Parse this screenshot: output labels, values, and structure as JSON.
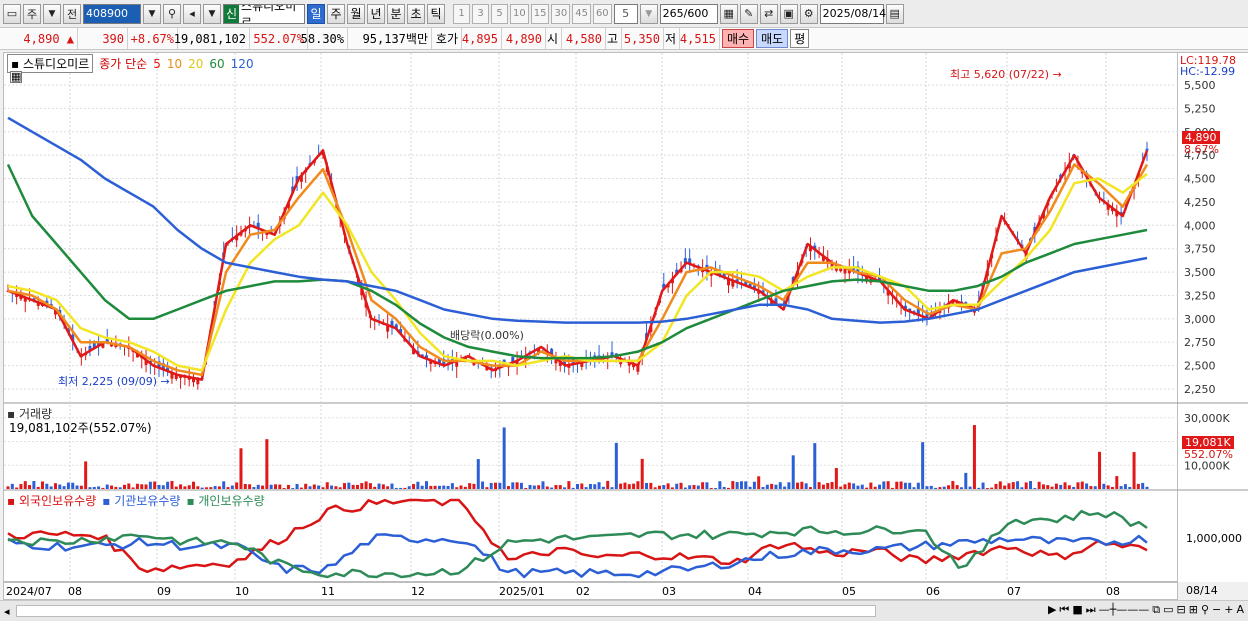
{
  "toolbar": {
    "market": "주",
    "prev_label": "전",
    "code": "408900",
    "name_tag": "신",
    "name": "스튜디오미르",
    "periods": [
      "일",
      "주",
      "월",
      "년",
      "분",
      "초",
      "틱"
    ],
    "active_period": "일",
    "intervals": [
      "1",
      "3",
      "5",
      "10",
      "15",
      "30",
      "45",
      "60"
    ],
    "interval_value": "5",
    "count": "265",
    "count_total": "/600",
    "date": "2025/08/14"
  },
  "quote": {
    "price": "4,890",
    "change": "390",
    "change_pct": "+8.67%",
    "volume": "19,081,102",
    "volume_pct": "552.07%",
    "turnover_pct": "58.30%",
    "amount": "95,137백만",
    "bid_label": "호가",
    "bid": "4,895",
    "ask": "4,890",
    "open_label": "시",
    "open": "4,580",
    "high_label": "고",
    "high": "5,350",
    "low_label": "저",
    "low": "4,515",
    "buy": "매수",
    "sell": "매도",
    "flat": "평"
  },
  "price_panel": {
    "stock_name": "스튜디오미르",
    "legend_label": "종가 단순",
    "ma_periods": [
      "5",
      "10",
      "20",
      "60",
      "120"
    ],
    "ma_colors": [
      "#e01818",
      "#f08a1c",
      "#f2e624",
      "#1e8a3c",
      "#2c5fd6"
    ],
    "lc": "LC:119.78",
    "hc": "HC:-12.99",
    "current_price_tag": "4,890",
    "current_pct_tag": "8.67%",
    "high_annotation": "최고 5,620 (07/22)",
    "low_annotation": "최저 2,225 (09/09)",
    "dividend_annotation": "배당락(0.00%)",
    "y_ticks": [
      "5,500",
      "5,250",
      "5,000",
      "4,750",
      "4,500",
      "4,250",
      "4,000",
      "3,750",
      "3,500",
      "3,250",
      "3,000",
      "2,750",
      "2,500",
      "2,250"
    ]
  },
  "volume_panel": {
    "title": "거래량",
    "value": "19,081,102주(552.07%)",
    "y_ticks": [
      "30,000K",
      "20,000K",
      "10,000K"
    ],
    "tag_value": "19,081K",
    "tag_pct": "552.07%"
  },
  "holdings_panel": {
    "series": [
      "외국인보유수량",
      "기관보유수량",
      "개인보유수량"
    ],
    "series_colors": [
      "#d81414",
      "#2c5fd6",
      "#2e8b57"
    ],
    "y_tick": "1,000,000"
  },
  "date_axis": [
    "2024/07",
    "08",
    "09",
    "10",
    "11",
    "12",
    "2025/01",
    "02",
    "03",
    "04",
    "05",
    "06",
    "07",
    "08",
    "08/14"
  ],
  "chart_data": {
    "type": "line",
    "x_range": [
      "2024/07",
      "2025/08/14"
    ],
    "ylim": [
      2100,
      5650
    ],
    "grid": true,
    "series": [
      {
        "name": "5",
        "values": [
          3300,
          3200,
          3100,
          2600,
          2750,
          2700,
          2500,
          2400,
          2350,
          3800,
          4000,
          3900,
          4500,
          4800,
          3800,
          3000,
          2900,
          2600,
          2500,
          2600,
          2450,
          2550,
          2700,
          2500,
          2550,
          2600,
          2500,
          3300,
          3600,
          3500,
          3400,
          3300,
          3100,
          3800,
          3600,
          3500,
          3400,
          3100,
          3000,
          3200,
          3100,
          4100,
          3700,
          4300,
          4750,
          4300,
          4100,
          4800
        ]
      },
      {
        "name": "10",
        "values": [
          3300,
          3250,
          3100,
          2750,
          2750,
          2700,
          2550,
          2450,
          2400,
          3500,
          3900,
          3950,
          4300,
          4600,
          3950,
          3200,
          3000,
          2700,
          2550,
          2550,
          2500,
          2500,
          2650,
          2550,
          2550,
          2550,
          2550,
          3000,
          3500,
          3550,
          3450,
          3350,
          3200,
          3600,
          3600,
          3500,
          3450,
          3200,
          3050,
          3150,
          3100,
          3700,
          3750,
          4150,
          4650,
          4450,
          4200,
          4650
        ]
      },
      {
        "name": "20",
        "values": [
          3350,
          3300,
          3200,
          2900,
          2800,
          2750,
          2650,
          2500,
          2450,
          3100,
          3600,
          3850,
          4000,
          4350,
          4000,
          3500,
          3200,
          2850,
          2600,
          2550,
          2550,
          2500,
          2550,
          2600,
          2550,
          2550,
          2550,
          2750,
          3250,
          3500,
          3500,
          3450,
          3300,
          3450,
          3550,
          3550,
          3450,
          3350,
          3100,
          3150,
          3150,
          3400,
          3650,
          3950,
          4450,
          4500,
          4350,
          4550
        ]
      },
      {
        "name": "60",
        "values": [
          4650,
          4100,
          3800,
          3500,
          3200,
          3000,
          3000,
          3100,
          3200,
          3300,
          3350,
          3400,
          3400,
          3420,
          3400,
          3300,
          3150,
          2950,
          2800,
          2700,
          2650,
          2600,
          2580,
          2580,
          2580,
          2600,
          2650,
          2750,
          2900,
          3000,
          3100,
          3200,
          3300,
          3350,
          3400,
          3420,
          3400,
          3350,
          3300,
          3300,
          3350,
          3450,
          3600,
          3700,
          3800,
          3850,
          3900,
          3950
        ]
      },
      {
        "name": "120",
        "values": [
          5150,
          5000,
          4850,
          4700,
          4500,
          4350,
          4200,
          3950,
          3750,
          3600,
          3550,
          3500,
          3450,
          3420,
          3400,
          3350,
          3300,
          3200,
          3100,
          3050,
          3000,
          2980,
          2970,
          2960,
          2960,
          2960,
          2960,
          2970,
          3000,
          3050,
          3100,
          3150,
          3150,
          3100,
          3000,
          2980,
          2960,
          2970,
          3000,
          3050,
          3100,
          3200,
          3300,
          3400,
          3500,
          3550,
          3600,
          3650
        ]
      }
    ]
  }
}
